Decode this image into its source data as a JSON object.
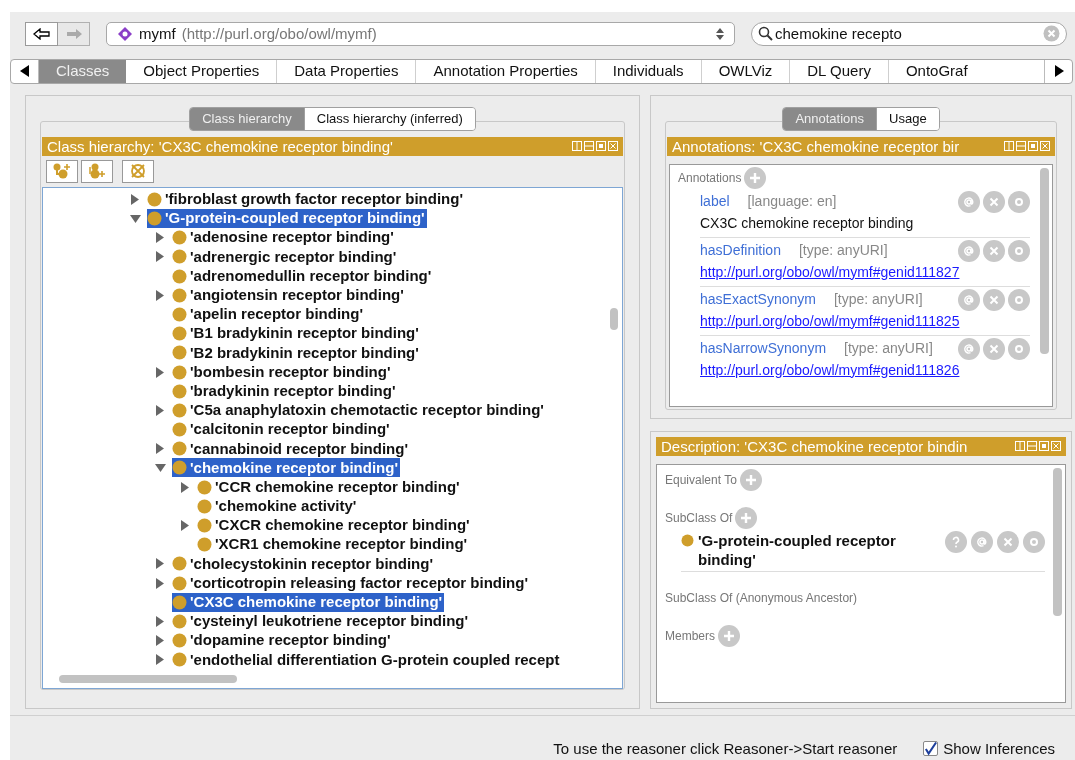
{
  "toolbar": {
    "ontology": {
      "name": "mymf",
      "iri": "(http://purl.org/obo/owl/mymf)"
    },
    "search": {
      "value": "chemokine recepto"
    }
  },
  "tabs": [
    {
      "label": "Classes",
      "selected": true
    },
    {
      "label": "Object Properties",
      "selected": false
    },
    {
      "label": "Data Properties",
      "selected": false
    },
    {
      "label": "Annotation Properties",
      "selected": false
    },
    {
      "label": "Individuals",
      "selected": false
    },
    {
      "label": "OWLViz",
      "selected": false
    },
    {
      "label": "DL Query",
      "selected": false
    },
    {
      "label": "OntoGraf",
      "selected": false
    }
  ],
  "left_panel": {
    "subtabs": [
      {
        "label": "Class hierarchy",
        "selected": true
      },
      {
        "label": "Class hierarchy (inferred)",
        "selected": false
      }
    ],
    "title": "Class hierarchy: 'CX3C chemokine receptor binding'",
    "tree": [
      {
        "label": "'fibroblast growth factor receptor binding'",
        "kind": "branch",
        "expanded": false,
        "selected": false
      },
      {
        "label": "'G-protein-coupled receptor binding'",
        "kind": "branch",
        "expanded": true,
        "selected": true,
        "children": [
          {
            "label": "'adenosine receptor binding'",
            "kind": "branch",
            "expanded": false,
            "selected": false
          },
          {
            "label": "'adrenergic receptor binding'",
            "kind": "branch",
            "expanded": false,
            "selected": false
          },
          {
            "label": "'adrenomedullin receptor binding'",
            "kind": "leaf",
            "selected": false
          },
          {
            "label": "'angiotensin receptor binding'",
            "kind": "branch",
            "expanded": false,
            "selected": false
          },
          {
            "label": "'apelin receptor binding'",
            "kind": "leaf",
            "selected": false
          },
          {
            "label": "'B1 bradykinin receptor binding'",
            "kind": "leaf",
            "selected": false
          },
          {
            "label": "'B2 bradykinin receptor binding'",
            "kind": "leaf",
            "selected": false
          },
          {
            "label": "'bombesin receptor binding'",
            "kind": "branch",
            "expanded": false,
            "selected": false
          },
          {
            "label": "'bradykinin receptor binding'",
            "kind": "leaf",
            "selected": false
          },
          {
            "label": "'C5a anaphylatoxin chemotactic receptor binding'",
            "kind": "branch",
            "expanded": false,
            "selected": false
          },
          {
            "label": "'calcitonin receptor binding'",
            "kind": "leaf",
            "selected": false
          },
          {
            "label": "'cannabinoid receptor binding'",
            "kind": "branch",
            "expanded": false,
            "selected": false
          },
          {
            "label": "'chemokine receptor binding'",
            "kind": "branch",
            "expanded": true,
            "selected": true,
            "children": [
              {
                "label": "'CCR chemokine receptor binding'",
                "kind": "branch",
                "expanded": false,
                "selected": false
              },
              {
                "label": "'chemokine activity'",
                "kind": "leaf",
                "selected": false
              },
              {
                "label": "'CXCR chemokine receptor binding'",
                "kind": "branch",
                "expanded": false,
                "selected": false
              },
              {
                "label": "'XCR1 chemokine receptor binding'",
                "kind": "leaf",
                "selected": false
              }
            ]
          },
          {
            "label": "'cholecystokinin receptor binding'",
            "kind": "branch",
            "expanded": false,
            "selected": false
          },
          {
            "label": "'corticotropin releasing factor receptor binding'",
            "kind": "branch",
            "expanded": false,
            "selected": false
          },
          {
            "label": "'CX3C chemokine receptor binding'",
            "kind": "leaf",
            "selected": true
          },
          {
            "label": "'cysteinyl leukotriene receptor binding'",
            "kind": "branch",
            "expanded": false,
            "selected": false
          },
          {
            "label": "'dopamine receptor binding'",
            "kind": "branch",
            "expanded": false,
            "selected": false
          },
          {
            "label": "'endothelial differentiation G-protein coupled recept",
            "kind": "branch",
            "expanded": false,
            "selected": false
          }
        ]
      }
    ]
  },
  "annotations_panel": {
    "subtabs": [
      {
        "label": "Annotations",
        "selected": true
      },
      {
        "label": "Usage",
        "selected": false
      }
    ],
    "title": "Annotations: 'CX3C chemokine receptor bir",
    "section": "Annotations",
    "entries": [
      {
        "property": "label",
        "qualifier": "[language: en]",
        "value": "CX3C chemokine receptor binding",
        "kind": "text"
      },
      {
        "property": "hasDefinition",
        "qualifier": "[type: anyURI]",
        "value": "http://purl.org/obo/owl/mymf#genid111827",
        "kind": "link"
      },
      {
        "property": "hasExactSynonym",
        "qualifier": "[type: anyURI]",
        "value": "http://purl.org/obo/owl/mymf#genid111825",
        "kind": "link"
      },
      {
        "property": "hasNarrowSynonym",
        "qualifier": "[type: anyURI]",
        "value": "http://purl.org/obo/owl/mymf#genid111826",
        "kind": "link"
      }
    ]
  },
  "description_panel": {
    "title": "Description: 'CX3C chemokine receptor bindin",
    "sections": [
      {
        "heading": "Equivalent To",
        "addable": true
      },
      {
        "heading": "SubClass Of",
        "addable": true,
        "items": [
          "'G-protein-coupled receptor binding'"
        ]
      },
      {
        "heading": "SubClass Of (Anonymous Ancestor)",
        "addable": false
      },
      {
        "heading": "Members",
        "addable": true
      }
    ]
  },
  "status_bar": {
    "message": "To use the reasoner click Reasoner->Start reasoner",
    "show_inferences": {
      "label": "Show Inferences",
      "checked": true
    }
  }
}
